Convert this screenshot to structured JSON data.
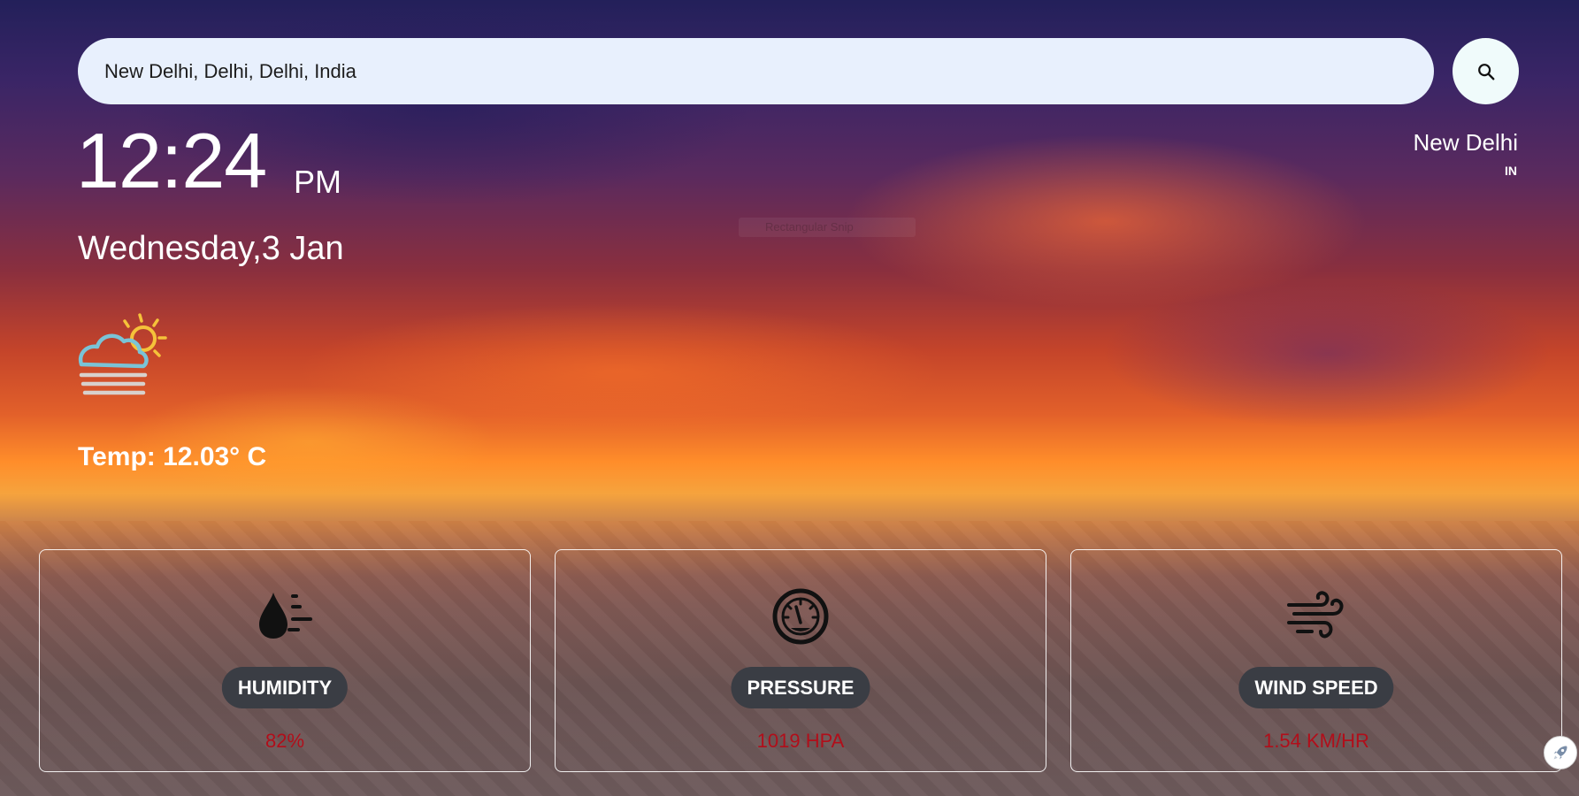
{
  "search": {
    "value": "New Delhi, Delhi, Delhi, India",
    "button_icon": "search-icon"
  },
  "clock": {
    "time": "12:24",
    "ampm": "PM",
    "date": "Wednesday,3 Jan"
  },
  "location": {
    "city": "New Delhi",
    "country": "IN"
  },
  "weather": {
    "icon": "partly-cloudy-fog-icon",
    "temp": "Temp: 12.03° C"
  },
  "overlay_text": "Rectangular Snip",
  "cards": [
    {
      "icon": "humidity-icon",
      "label": "HUMIDITY",
      "value": "82%"
    },
    {
      "icon": "pressure-gauge-icon",
      "label": "PRESSURE",
      "value": "1019 HPA"
    },
    {
      "icon": "wind-icon",
      "label": "WIND SPEED",
      "value": "1.54 KM/HR"
    }
  ],
  "colors": {
    "value_text": "#b10e1a",
    "label_bg": "#3a3d44",
    "search_bg": "#e8f0fd"
  }
}
